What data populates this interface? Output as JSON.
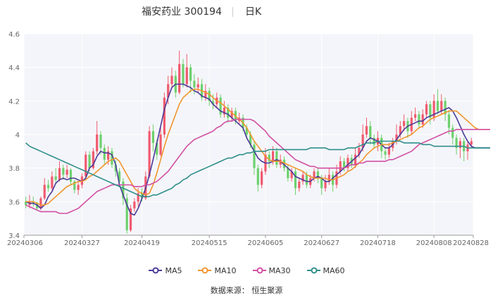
{
  "header": {
    "title": "福安药业 300194",
    "period": "日K"
  },
  "source": "数据来源：  恒生聚源",
  "colors": {
    "up": "#f05a6e",
    "down": "#6dd16d"
  },
  "chart_data": {
    "type": "candlestick",
    "title": "福安药业 300194",
    "ylim": [
      3.4,
      4.6
    ],
    "yticks": [
      "3.4",
      "3.6",
      "3.8",
      "4",
      "4.2",
      "4.4",
      "4.6"
    ],
    "xticks": [
      {
        "index": 0,
        "label": "20240306"
      },
      {
        "index": 15,
        "label": "20240327"
      },
      {
        "index": 31,
        "label": "20240419"
      },
      {
        "index": 49,
        "label": "20240515"
      },
      {
        "index": 64,
        "label": "20240605"
      },
      {
        "index": 79,
        "label": "20240627"
      },
      {
        "index": 94,
        "label": "20240718"
      },
      {
        "index": 109,
        "label": "20240808"
      },
      {
        "index": 123,
        "label": "20240828"
      }
    ],
    "grid": true,
    "legend_position": "bottom",
    "candles": [
      [
        3.6,
        3.58,
        3.63,
        3.56
      ],
      [
        3.58,
        3.6,
        3.64,
        3.56
      ],
      [
        3.6,
        3.59,
        3.63,
        3.57
      ],
      [
        3.59,
        3.56,
        3.6,
        3.55
      ],
      [
        3.56,
        3.62,
        3.63,
        3.55
      ],
      [
        3.62,
        3.7,
        3.74,
        3.61
      ],
      [
        3.7,
        3.68,
        3.73,
        3.66
      ],
      [
        3.68,
        3.75,
        3.78,
        3.67
      ],
      [
        3.75,
        3.73,
        3.8,
        3.71
      ],
      [
        3.73,
        3.8,
        3.84,
        3.72
      ],
      [
        3.8,
        3.76,
        3.82,
        3.73
      ],
      [
        3.76,
        3.79,
        3.82,
        3.74
      ],
      [
        3.79,
        3.72,
        3.8,
        3.7
      ],
      [
        3.72,
        3.67,
        3.73,
        3.65
      ],
      [
        3.67,
        3.7,
        3.72,
        3.64
      ],
      [
        3.7,
        3.75,
        3.77,
        3.68
      ],
      [
        3.75,
        3.88,
        3.9,
        3.74
      ],
      [
        3.88,
        3.8,
        3.9,
        3.78
      ],
      [
        3.8,
        3.9,
        3.92,
        3.79
      ],
      [
        3.9,
        4.0,
        4.08,
        3.88
      ],
      [
        4.0,
        3.92,
        4.02,
        3.88
      ],
      [
        3.92,
        3.85,
        3.94,
        3.82
      ],
      [
        3.85,
        3.9,
        3.93,
        3.82
      ],
      [
        3.9,
        3.82,
        3.92,
        3.8
      ],
      [
        3.82,
        3.78,
        3.85,
        3.75
      ],
      [
        3.78,
        3.72,
        3.8,
        3.7
      ],
      [
        3.72,
        3.62,
        3.74,
        3.58
      ],
      [
        3.62,
        3.43,
        3.65,
        3.41
      ],
      [
        3.43,
        3.56,
        3.58,
        3.42
      ],
      [
        3.56,
        3.6,
        3.62,
        3.54
      ],
      [
        3.6,
        3.65,
        3.68,
        3.57
      ],
      [
        3.65,
        3.62,
        3.68,
        3.6
      ],
      [
        3.62,
        3.75,
        3.78,
        3.61
      ],
      [
        3.75,
        4.02,
        4.05,
        3.74
      ],
      [
        4.02,
        3.95,
        4.06,
        3.9
      ],
      [
        3.95,
        3.88,
        3.97,
        3.85
      ],
      [
        3.88,
        4.0,
        4.05,
        3.87
      ],
      [
        4.0,
        4.22,
        4.25,
        3.98
      ],
      [
        4.22,
        4.3,
        4.35,
        4.18
      ],
      [
        4.3,
        4.35,
        4.4,
        4.28
      ],
      [
        4.35,
        4.25,
        4.38,
        4.22
      ],
      [
        4.25,
        4.42,
        4.5,
        4.24
      ],
      [
        4.42,
        4.3,
        4.45,
        4.28
      ],
      [
        4.3,
        4.4,
        4.48,
        4.28
      ],
      [
        4.4,
        4.32,
        4.42,
        4.25
      ],
      [
        4.32,
        4.28,
        4.36,
        4.24
      ],
      [
        4.28,
        4.3,
        4.34,
        4.25
      ],
      [
        4.3,
        4.22,
        4.33,
        4.2
      ],
      [
        4.22,
        4.26,
        4.3,
        4.2
      ],
      [
        4.26,
        4.2,
        4.28,
        4.17
      ],
      [
        4.2,
        4.18,
        4.24,
        4.15
      ],
      [
        4.18,
        4.22,
        4.25,
        4.16
      ],
      [
        4.22,
        4.12,
        4.24,
        4.1
      ],
      [
        4.12,
        4.16,
        4.2,
        4.1
      ],
      [
        4.16,
        4.1,
        4.18,
        4.07
      ],
      [
        4.1,
        4.14,
        4.16,
        4.08
      ],
      [
        4.14,
        4.08,
        4.16,
        4.06
      ],
      [
        4.08,
        4.1,
        4.13,
        4.06
      ],
      [
        4.1,
        4.04,
        4.12,
        4.02
      ],
      [
        4.04,
        4.0,
        4.06,
        3.98
      ],
      [
        4.0,
        3.94,
        4.02,
        3.92
      ],
      [
        3.94,
        3.8,
        3.96,
        3.76
      ],
      [
        3.8,
        3.7,
        3.82,
        3.66
      ],
      [
        3.7,
        3.78,
        3.8,
        3.68
      ],
      [
        3.78,
        3.88,
        3.92,
        3.76
      ],
      [
        3.88,
        3.84,
        3.9,
        3.8
      ],
      [
        3.84,
        3.9,
        3.93,
        3.82
      ],
      [
        3.9,
        3.82,
        3.92,
        3.8
      ],
      [
        3.82,
        3.85,
        3.88,
        3.8
      ],
      [
        3.85,
        3.8,
        3.87,
        3.78
      ],
      [
        3.8,
        3.74,
        3.82,
        3.72
      ],
      [
        3.74,
        3.78,
        3.8,
        3.72
      ],
      [
        3.78,
        3.68,
        3.8,
        3.64
      ],
      [
        3.68,
        3.72,
        3.74,
        3.66
      ],
      [
        3.72,
        3.76,
        3.78,
        3.7
      ],
      [
        3.76,
        3.7,
        3.78,
        3.68
      ],
      [
        3.7,
        3.74,
        3.76,
        3.68
      ],
      [
        3.74,
        3.78,
        3.8,
        3.72
      ],
      [
        3.78,
        3.74,
        3.8,
        3.71
      ],
      [
        3.74,
        3.68,
        3.76,
        3.64
      ],
      [
        3.68,
        3.72,
        3.76,
        3.66
      ],
      [
        3.72,
        3.76,
        3.8,
        3.7
      ],
      [
        3.76,
        3.7,
        3.78,
        3.66
      ],
      [
        3.7,
        3.78,
        3.82,
        3.68
      ],
      [
        3.78,
        3.84,
        3.87,
        3.76
      ],
      [
        3.84,
        3.8,
        3.86,
        3.78
      ],
      [
        3.8,
        3.86,
        3.88,
        3.78
      ],
      [
        3.86,
        3.82,
        3.88,
        3.8
      ],
      [
        3.82,
        3.88,
        3.92,
        3.8
      ],
      [
        3.88,
        3.92,
        3.95,
        3.86
      ],
      [
        3.92,
        4.0,
        4.06,
        3.9
      ],
      [
        4.0,
        4.05,
        4.1,
        3.98
      ],
      [
        4.05,
        3.98,
        4.08,
        3.94
      ],
      [
        3.98,
        3.94,
        4.0,
        3.92
      ],
      [
        3.94,
        3.98,
        4.02,
        3.9
      ],
      [
        3.98,
        3.9,
        4.0,
        3.86
      ],
      [
        3.9,
        3.88,
        3.92,
        3.85
      ],
      [
        3.88,
        3.92,
        3.95,
        3.86
      ],
      [
        3.92,
        3.96,
        3.98,
        3.9
      ],
      [
        3.96,
        4.0,
        4.06,
        3.94
      ],
      [
        4.0,
        4.05,
        4.08,
        3.98
      ],
      [
        4.05,
        4.08,
        4.12,
        4.02
      ],
      [
        4.08,
        4.02,
        4.1,
        3.98
      ],
      [
        4.02,
        4.1,
        4.14,
        4.0
      ],
      [
        4.1,
        4.12,
        4.16,
        4.08
      ],
      [
        4.12,
        4.06,
        4.14,
        4.04
      ],
      [
        4.06,
        4.12,
        4.15,
        4.04
      ],
      [
        4.12,
        4.18,
        4.2,
        4.1
      ],
      [
        4.18,
        4.1,
        4.2,
        4.06
      ],
      [
        4.1,
        4.2,
        4.24,
        4.08
      ],
      [
        4.2,
        4.14,
        4.27,
        4.12
      ],
      [
        4.14,
        4.2,
        4.24,
        4.12
      ],
      [
        4.2,
        4.12,
        4.22,
        4.08
      ],
      [
        4.12,
        4.04,
        4.14,
        4.0
      ],
      [
        4.04,
        3.98,
        4.06,
        3.94
      ],
      [
        3.98,
        3.92,
        4.0,
        3.88
      ],
      [
        3.92,
        3.96,
        3.98,
        3.86
      ],
      [
        3.96,
        3.9,
        3.98,
        3.84
      ],
      [
        3.9,
        3.94,
        3.96,
        3.85
      ],
      [
        3.94,
        3.96,
        3.98,
        3.92
      ]
    ],
    "series": [
      {
        "name": "MA5",
        "color": "#4b3a96",
        "values": [
          3.6,
          3.59,
          3.59,
          3.58,
          3.56,
          3.58,
          3.63,
          3.66,
          3.71,
          3.73,
          3.74,
          3.73,
          3.74,
          3.74,
          3.73,
          3.72,
          3.74,
          3.8,
          3.82,
          3.87,
          3.9,
          3.89,
          3.89,
          3.88,
          3.82,
          3.7,
          3.64,
          3.58,
          3.53,
          3.52,
          3.56,
          3.62,
          3.68,
          3.76,
          3.85,
          3.95,
          4.05,
          4.15,
          4.22,
          4.28,
          4.3,
          4.3,
          4.3,
          4.29,
          4.28,
          4.26,
          4.25,
          4.23,
          4.22,
          4.21,
          4.18,
          4.16,
          4.14,
          4.13,
          4.12,
          4.1,
          4.08,
          4.06,
          4.04,
          3.98,
          3.94,
          3.9,
          3.86,
          3.84,
          3.83,
          3.83,
          3.84,
          3.85,
          3.84,
          3.82,
          3.8,
          3.78,
          3.75,
          3.74,
          3.73,
          3.72,
          3.72,
          3.74,
          3.75,
          3.74,
          3.72,
          3.72,
          3.74,
          3.76,
          3.78,
          3.8,
          3.82,
          3.84,
          3.86,
          3.88,
          3.92,
          3.96,
          3.98,
          3.97,
          3.96,
          3.94,
          3.92,
          3.92,
          3.94,
          3.97,
          4.0,
          4.03,
          4.05,
          4.06,
          4.07,
          4.08,
          4.08,
          4.1,
          4.11,
          4.12,
          4.13,
          4.14,
          4.15,
          4.16,
          4.14,
          4.1,
          4.05,
          4.0,
          3.96,
          3.93,
          3.92,
          3.92,
          3.92,
          3.92,
          3.92
        ]
      },
      {
        "name": "MA10",
        "color": "#f0962d",
        "values": [
          3.6,
          3.6,
          3.6,
          3.59,
          3.58,
          3.58,
          3.59,
          3.61,
          3.63,
          3.65,
          3.67,
          3.69,
          3.7,
          3.71,
          3.72,
          3.72,
          3.73,
          3.75,
          3.76,
          3.78,
          3.8,
          3.82,
          3.84,
          3.85,
          3.86,
          3.84,
          3.8,
          3.76,
          3.72,
          3.68,
          3.66,
          3.65,
          3.64,
          3.65,
          3.7,
          3.77,
          3.85,
          3.93,
          4.0,
          4.06,
          4.12,
          4.18,
          4.22,
          4.24,
          4.26,
          4.27,
          4.27,
          4.26,
          4.25,
          4.24,
          4.22,
          4.2,
          4.19,
          4.17,
          4.15,
          4.13,
          4.11,
          4.09,
          4.07,
          4.04,
          4.0,
          3.96,
          3.93,
          3.9,
          3.87,
          3.85,
          3.84,
          3.84,
          3.84,
          3.83,
          3.82,
          3.81,
          3.8,
          3.79,
          3.78,
          3.76,
          3.75,
          3.74,
          3.74,
          3.74,
          3.74,
          3.73,
          3.73,
          3.74,
          3.75,
          3.76,
          3.78,
          3.79,
          3.81,
          3.83,
          3.85,
          3.88,
          3.9,
          3.92,
          3.93,
          3.94,
          3.94,
          3.94,
          3.95,
          3.96,
          3.97,
          3.98,
          3.99,
          4.0,
          4.02,
          4.04,
          4.05,
          4.07,
          4.09,
          4.1,
          4.11,
          4.12,
          4.13,
          4.14,
          4.14,
          4.14,
          4.12,
          4.1,
          4.08,
          4.06,
          4.04,
          4.03,
          4.03,
          4.03,
          4.03
        ]
      },
      {
        "name": "MA30",
        "color": "#d24fa3",
        "values": [
          3.58,
          3.57,
          3.56,
          3.55,
          3.54,
          3.54,
          3.54,
          3.54,
          3.54,
          3.53,
          3.53,
          3.53,
          3.54,
          3.55,
          3.56,
          3.58,
          3.6,
          3.62,
          3.64,
          3.66,
          3.67,
          3.68,
          3.69,
          3.7,
          3.7,
          3.7,
          3.7,
          3.7,
          3.7,
          3.69,
          3.69,
          3.69,
          3.7,
          3.7,
          3.71,
          3.72,
          3.74,
          3.76,
          3.78,
          3.81,
          3.84,
          3.87,
          3.9,
          3.93,
          3.95,
          3.97,
          3.98,
          3.99,
          4.0,
          4.01,
          4.02,
          4.04,
          4.05,
          4.07,
          4.08,
          4.08,
          4.09,
          4.09,
          4.09,
          4.09,
          4.09,
          4.08,
          4.06,
          4.04,
          4.02,
          3.99,
          3.97,
          3.95,
          3.93,
          3.91,
          3.89,
          3.87,
          3.85,
          3.84,
          3.83,
          3.82,
          3.81,
          3.81,
          3.8,
          3.8,
          3.8,
          3.8,
          3.8,
          3.8,
          3.8,
          3.8,
          3.81,
          3.82,
          3.82,
          3.83,
          3.83,
          3.84,
          3.84,
          3.84,
          3.84,
          3.84,
          3.84,
          3.85,
          3.85,
          3.86,
          3.87,
          3.88,
          3.89,
          3.9,
          3.92,
          3.94,
          3.95,
          3.96,
          3.97,
          3.98,
          3.99,
          4.0,
          4.01,
          4.02,
          4.02,
          4.03,
          4.03,
          4.03,
          4.03,
          4.03,
          4.03,
          4.03,
          4.03,
          4.03,
          4.03
        ]
      },
      {
        "name": "MA60",
        "color": "#2f8f8b",
        "values": [
          3.95,
          3.93,
          3.92,
          3.91,
          3.9,
          3.89,
          3.88,
          3.87,
          3.86,
          3.85,
          3.84,
          3.83,
          3.82,
          3.81,
          3.8,
          3.79,
          3.78,
          3.77,
          3.76,
          3.75,
          3.74,
          3.73,
          3.72,
          3.71,
          3.7,
          3.69,
          3.68,
          3.67,
          3.66,
          3.65,
          3.64,
          3.63,
          3.63,
          3.63,
          3.64,
          3.64,
          3.65,
          3.66,
          3.67,
          3.68,
          3.7,
          3.71,
          3.73,
          3.74,
          3.76,
          3.77,
          3.78,
          3.79,
          3.8,
          3.81,
          3.82,
          3.83,
          3.84,
          3.85,
          3.86,
          3.86,
          3.87,
          3.88,
          3.88,
          3.89,
          3.89,
          3.9,
          3.9,
          3.9,
          3.9,
          3.91,
          3.91,
          3.91,
          3.91,
          3.91,
          3.91,
          3.91,
          3.91,
          3.91,
          3.91,
          3.91,
          3.92,
          3.92,
          3.92,
          3.92,
          3.92,
          3.91,
          3.91,
          3.91,
          3.91,
          3.91,
          3.92,
          3.92,
          3.92,
          3.93,
          3.94,
          3.95,
          3.95,
          3.95,
          3.96,
          3.96,
          3.96,
          3.96,
          3.96,
          3.96,
          3.96,
          3.95,
          3.95,
          3.95,
          3.95,
          3.95,
          3.94,
          3.94,
          3.94,
          3.93,
          3.93,
          3.93,
          3.93,
          3.93,
          3.93,
          3.93,
          3.93,
          3.93,
          3.92,
          3.92,
          3.92,
          3.92,
          3.92,
          3.92,
          3.92
        ]
      }
    ]
  }
}
